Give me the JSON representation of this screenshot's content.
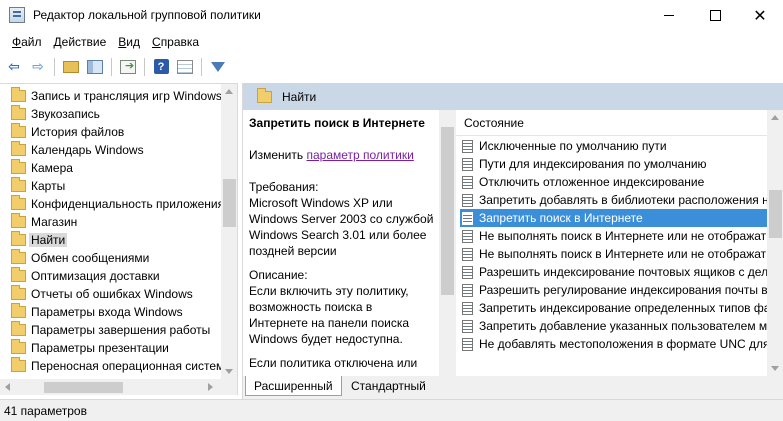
{
  "window": {
    "title": "Редактор локальной групповой политики"
  },
  "menu": {
    "items": [
      {
        "label": "Файл",
        "accel": "Ф"
      },
      {
        "label": "Действие",
        "accel": "Д"
      },
      {
        "label": "Вид",
        "accel": "В"
      },
      {
        "label": "Справка",
        "accel": "С"
      }
    ]
  },
  "toolbar": {
    "icons": [
      "back-icon",
      "forward-icon",
      "up-folder-icon",
      "show-hide-tree-icon",
      "export-list-icon",
      "help-icon",
      "extended-view-icon",
      "filter-icon"
    ]
  },
  "tree": {
    "items": [
      {
        "label": "Запись и трансляция игр Windows"
      },
      {
        "label": "Звукозапись"
      },
      {
        "label": "История файлов"
      },
      {
        "label": "Календарь Windows"
      },
      {
        "label": "Камера"
      },
      {
        "label": "Карты"
      },
      {
        "label": "Конфиденциальность приложения"
      },
      {
        "label": "Магазин"
      },
      {
        "label": "Найти"
      },
      {
        "label": "Обмен сообщениями"
      },
      {
        "label": "Оптимизация доставки"
      },
      {
        "label": "Отчеты об ошибках Windows"
      },
      {
        "label": "Параметры входа Windows"
      },
      {
        "label": "Параметры завершения работы"
      },
      {
        "label": "Параметры презентации"
      },
      {
        "label": "Переносная операционная система"
      }
    ],
    "selected_label": "Найти"
  },
  "right_header": {
    "title": "Найти"
  },
  "description": {
    "title": "Запретить поиск в Интернете",
    "edit_prefix": "Изменить ",
    "edit_link": "параметр политики",
    "requirements_label": "Требования:",
    "requirements_text": "Microsoft Windows XP или Windows Server 2003 со службой Windows Search 3.01 или более поздней версии",
    "description_label": "Описание:",
    "description_text": "Если включить эту политику, возможность поиска в Интернете на панели поиска Windows будет недоступна.",
    "disabled_text": "Если политика отключена или"
  },
  "policy_list": {
    "column_header": "Состояние",
    "items": [
      {
        "label": "Исключенные по умолчанию пути"
      },
      {
        "label": "Пути для индексирования по умолчанию"
      },
      {
        "label": "Отключить отложенное индексирование"
      },
      {
        "label": "Запретить добавлять в библиотеки расположения н"
      },
      {
        "label": "Запретить поиск в Интернете"
      },
      {
        "label": "Не выполнять поиск в Интернете или не отображат"
      },
      {
        "label": "Не выполнять поиск в Интернете или не отображат"
      },
      {
        "label": "Разрешить индексирование почтовых ящиков с дел"
      },
      {
        "label": "Разрешить регулирование индексирования почты в"
      },
      {
        "label": "Запретить индексирование определенных типов фа"
      },
      {
        "label": "Запретить добавление указанных пользователем м"
      },
      {
        "label": "Не добавлять местоположения в формате UNC для"
      }
    ],
    "selected_label": "Запретить поиск в Интернете"
  },
  "tabs": [
    {
      "label": "Расширенный"
    },
    {
      "label": "Стандартный"
    }
  ],
  "status": {
    "text": "41 параметров"
  },
  "colors": {
    "selection": "#3b8fd9",
    "header_band": "#c9d7e6",
    "link": "#7a1fa2"
  }
}
